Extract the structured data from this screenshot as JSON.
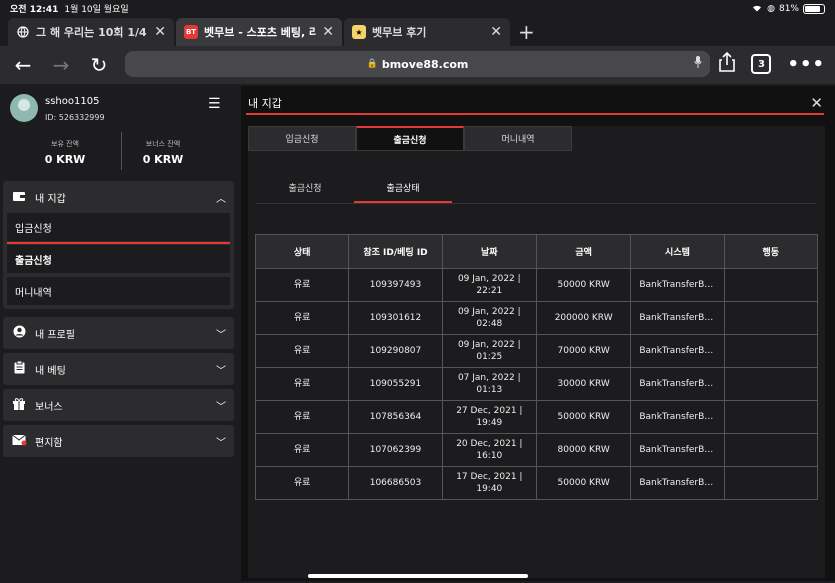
{
  "status": {
    "time": "오전 12:41",
    "date": "1월 10일 월요일",
    "battery": "81%",
    "battery_level": 0.81
  },
  "tabs": [
    {
      "label": "그 해 우리는 10회 1/4",
      "icon": "globe-icon"
    },
    {
      "label": "벳무브 - 스포츠 베팅, 라이브",
      "icon": "bm-logo-icon"
    },
    {
      "label": "벳무브 후기",
      "icon": "review-icon"
    }
  ],
  "toolbar": {
    "url": "bmove88.com",
    "tab_count": "3"
  },
  "profile": {
    "username": "sshoo1105",
    "user_id": "ID: 526332999",
    "balance_label": "보유 잔액",
    "balance_value": "0 KRW",
    "bonus_label": "보너스 잔액",
    "bonus_value": "0 KRW"
  },
  "sidebar": {
    "wallet": {
      "label": "내 지갑",
      "items": [
        "입금신청",
        "출금신청",
        "머니내역"
      ]
    },
    "profile": "내 프로필",
    "betting": "내 베팅",
    "bonus": "보너스",
    "inbox": "편지함"
  },
  "modal": {
    "title": "내 지갑",
    "tabs": [
      "입금신청",
      "출금신청",
      "머니내역"
    ],
    "subtabs": [
      "출금신청",
      "출금상태"
    ],
    "table": {
      "headers": [
        "상태",
        "참조 ID/베팅 ID",
        "날짜",
        "금액",
        "시스템",
        "행동"
      ],
      "rows": [
        [
          "유료",
          "109397493",
          "09 Jan, 2022 |",
          "22:21",
          "50000 KRW",
          "BankTransferB…"
        ],
        [
          "유료",
          "109301612",
          "09 Jan, 2022 |",
          "02:48",
          "200000 KRW",
          "BankTransferB…"
        ],
        [
          "유료",
          "109290807",
          "09 Jan, 2022 |",
          "01:25",
          "70000 KRW",
          "BankTransferB…"
        ],
        [
          "유료",
          "109055291",
          "07 Jan, 2022 |",
          "01:13",
          "30000 KRW",
          "BankTransferB…"
        ],
        [
          "유료",
          "107856364",
          "27 Dec, 2021 |",
          "19:49",
          "50000 KRW",
          "BankTransferB…"
        ],
        [
          "유료",
          "107062399",
          "20 Dec, 2021 |",
          "16:10",
          "80000 KRW",
          "BankTransferB…"
        ],
        [
          "유료",
          "106686503",
          "17 Dec, 2021 |",
          "19:40",
          "50000 KRW",
          "BankTransferB…"
        ]
      ]
    }
  }
}
